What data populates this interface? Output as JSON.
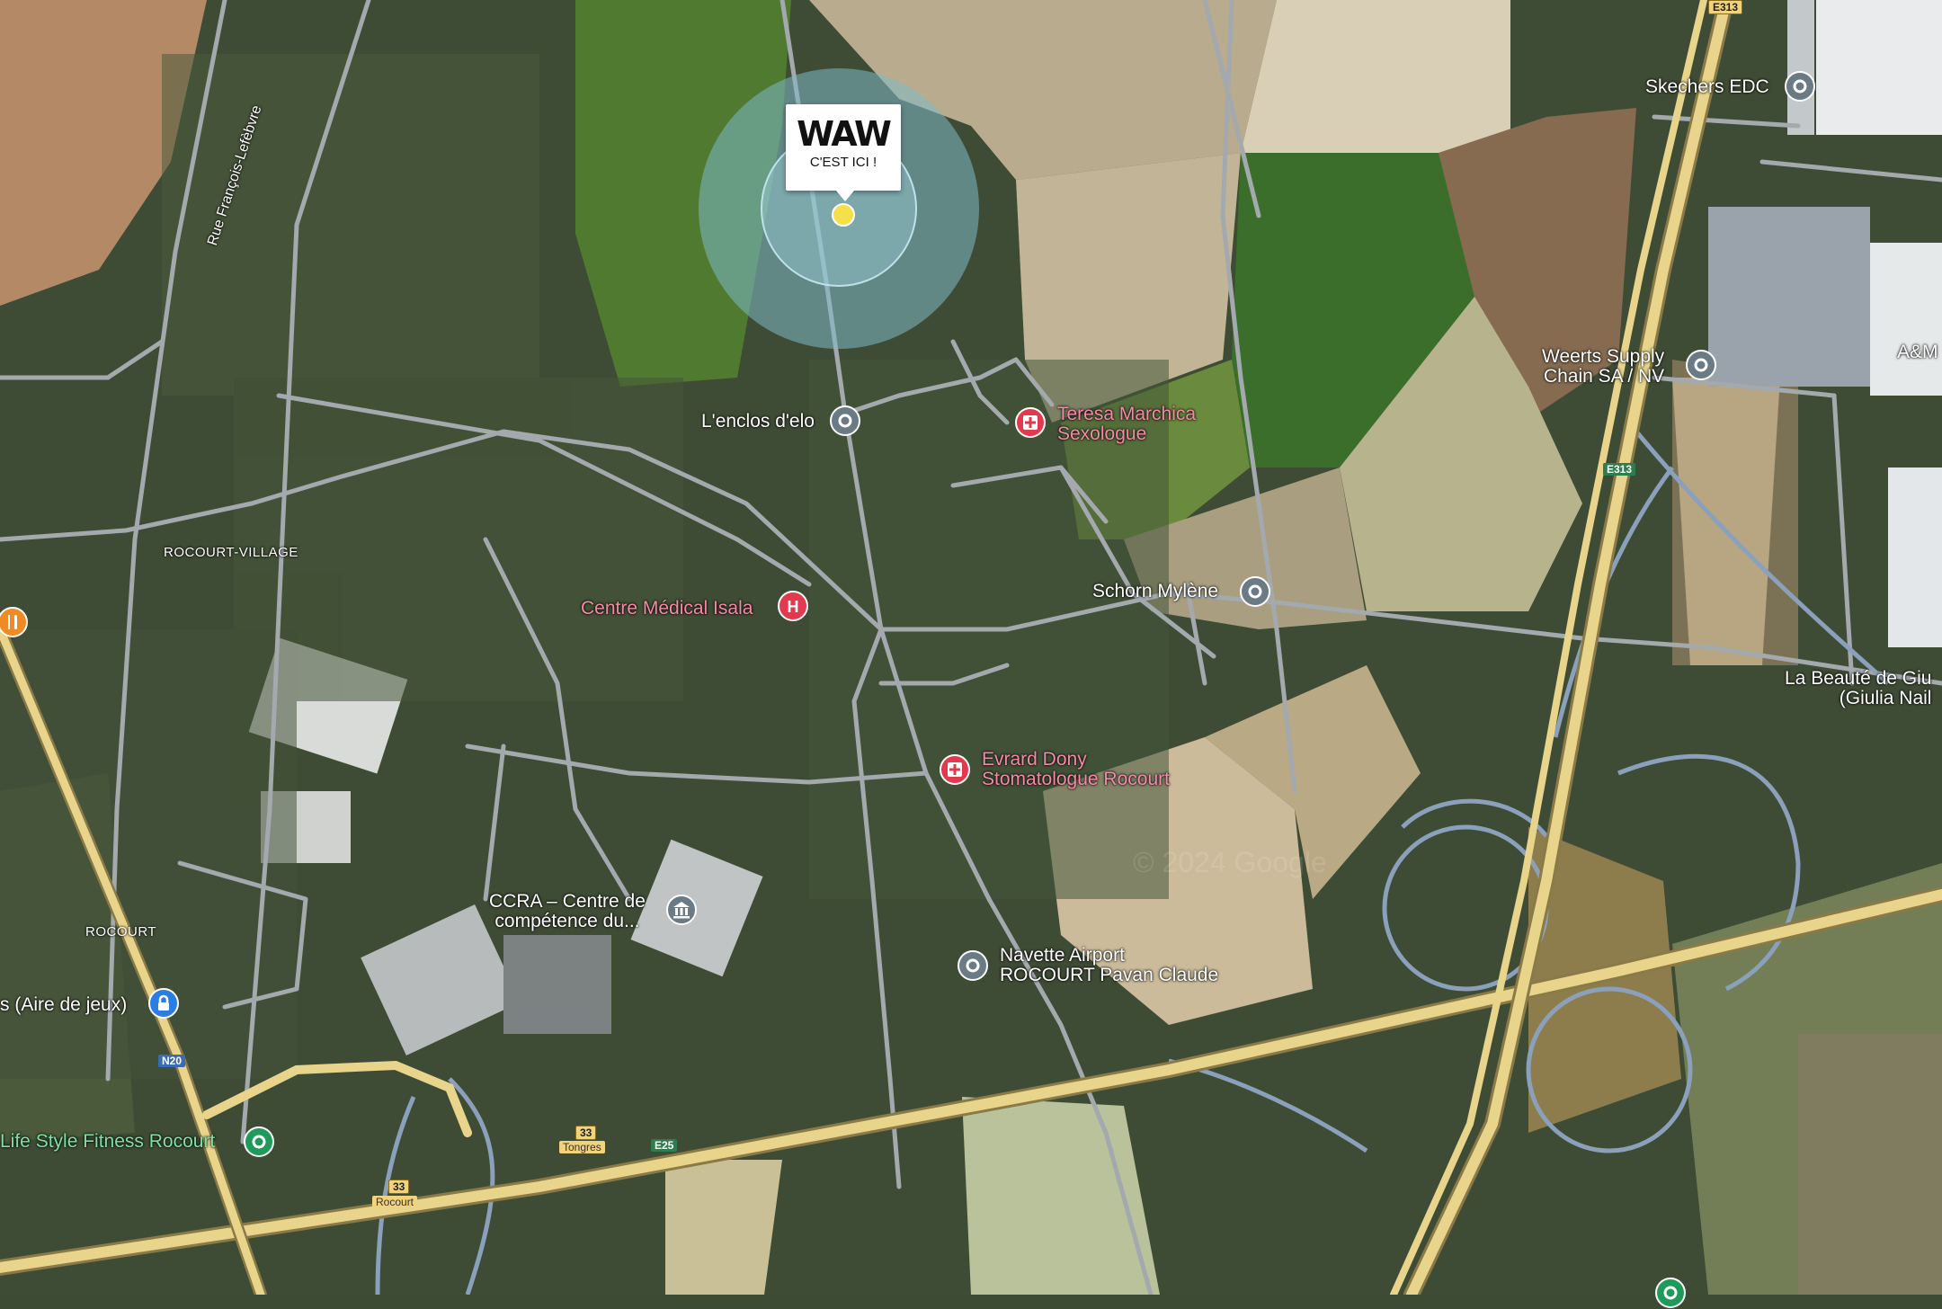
{
  "marker": {
    "logo": "WAW",
    "tagline": "C'EST ICI !"
  },
  "places": {
    "rocourt_village": "ROCOURT-VILLAGE",
    "rocourt": "ROCOURT"
  },
  "streets": {
    "rue_francois": "Rue François-Lefèbvre"
  },
  "pois": [
    {
      "id": "skechers",
      "label": "Skechers EDC",
      "kind": "generic",
      "color": "#ffffff"
    },
    {
      "id": "weerts",
      "label": "Weerts Supply\nChain SA / NV",
      "kind": "generic",
      "color": "#ffffff"
    },
    {
      "id": "am",
      "label": "A&M",
      "kind": "text",
      "color": "#ffffff"
    },
    {
      "id": "enclos",
      "label": "L'enclos d'elo",
      "kind": "generic",
      "color": "#ffffff"
    },
    {
      "id": "teresa",
      "label": "Teresa Marchica\nSexologue",
      "kind": "medical",
      "color": "#f48aa7"
    },
    {
      "id": "isala",
      "label": "Centre Médical Isala",
      "kind": "hospital",
      "color": "#f48aa7"
    },
    {
      "id": "schorn",
      "label": "Schorn Mylène",
      "kind": "generic",
      "color": "#ffffff"
    },
    {
      "id": "beaute",
      "label": "La Beauté de Giu\n(Giulia Nail",
      "kind": "text",
      "color": "#ffffff"
    },
    {
      "id": "evrard",
      "label": "Evrard Dony\nStomatologue Rocourt",
      "kind": "medical",
      "color": "#f48aa7"
    },
    {
      "id": "ccra",
      "label": "CCRA – Centre de\ncompétence du...",
      "kind": "institution",
      "color": "#ffffff"
    },
    {
      "id": "navette",
      "label": "Navette Airport\nROCOURT Pavan Claude",
      "kind": "generic",
      "color": "#ffffff"
    },
    {
      "id": "aire",
      "label": "s (Aire de jeux)",
      "kind": "playground",
      "color": "#ffffff"
    },
    {
      "id": "lifestyle",
      "label": "Life Style Fitness Rocourt",
      "kind": "fitness",
      "color": "#7fe0a8"
    }
  ],
  "road_shields": {
    "e313_top": "E313",
    "e313_mid": "E313",
    "n20": "N20",
    "e25": "E25",
    "exit33_a": "33",
    "exit33_a_name": "Tongres",
    "exit33_b": "33",
    "exit33_b_name": "Rocourt"
  },
  "watermark": "© 2024 Google",
  "colors": {
    "pin_grey": "#6b7b85",
    "pin_red": "#e2394f",
    "pin_green": "#1e9a5a",
    "pin_blue": "#2a7de1",
    "pin_orange": "#f08a24",
    "marker_dot": "#f5e04a",
    "radius_ring": "#7fb9c8"
  }
}
